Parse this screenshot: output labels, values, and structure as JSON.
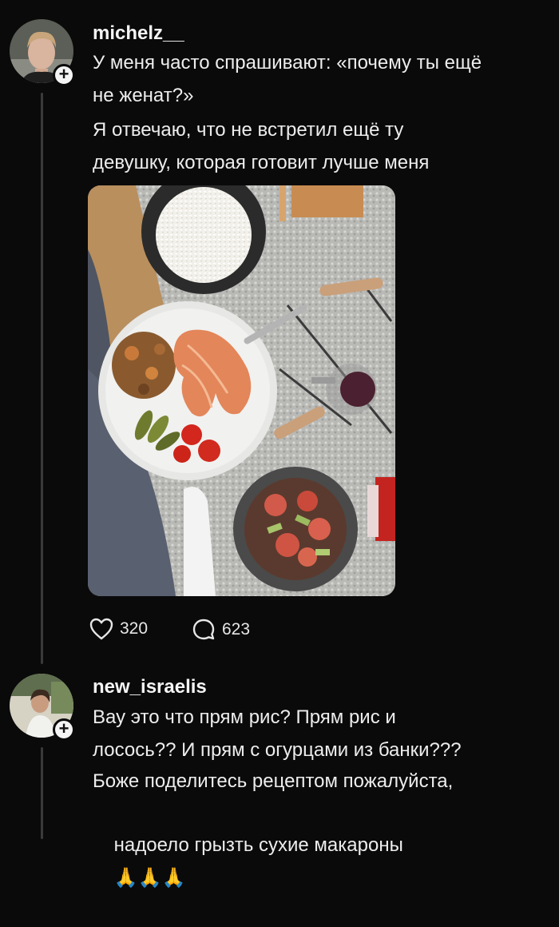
{
  "post": {
    "username": "michelz__",
    "text_line1": "У меня часто спрашивают: «почему ты ещё",
    "text_line2": "не женат?»",
    "text_line3": "Я отвечаю, что не встретил ещё ту",
    "text_line4": "девушку, которая готовит лучше меня",
    "likes": "320",
    "comments": "623",
    "like_icon": "heart-icon",
    "comment_icon": "speech-bubble-icon"
  },
  "reply": {
    "username": "new_israelis",
    "text_line1": "Вау это что прям рис? Прям рис и",
    "text_line2": "лосось?? И прям с огурцами из банки???",
    "text_line3": "Боже поделитесь рецептом пожалуйста,",
    "text_line4": "надоело грызть сухие макароны",
    "emoji": "🙏🙏🙏"
  },
  "colors": {
    "background": "#0a0a0a",
    "text": "#ededed",
    "thread_line": "#3a3a3a"
  }
}
